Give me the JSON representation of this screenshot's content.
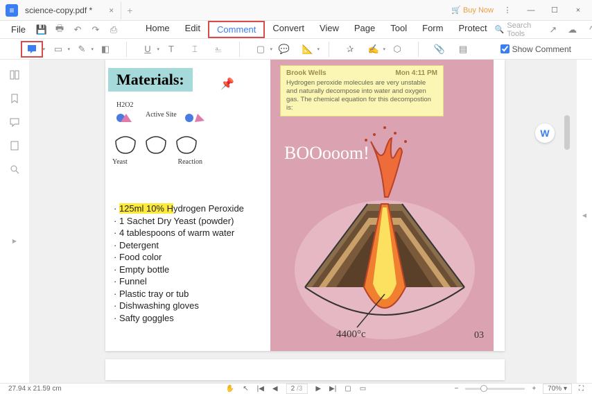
{
  "titlebar": {
    "tab_title": "science-copy.pdf *",
    "buy_now": "Buy Now"
  },
  "menu": {
    "file": "File",
    "tabs": [
      "Home",
      "Edit",
      "Comment",
      "Convert",
      "View",
      "Page",
      "Tool",
      "Form",
      "Protect"
    ],
    "active_tab": "Comment",
    "search_placeholder": "Search Tools"
  },
  "toolbar": {
    "show_comment": "Show Comment",
    "show_comment_checked": true
  },
  "page": {
    "header": "Materials:",
    "diagram": {
      "h2o2": "H2O2",
      "active_site": "Active Site",
      "yeast": "Yeast",
      "reaction": "Reaction"
    },
    "highlight_text": "125ml 10% H",
    "mat_rest_1": "ydrogen Peroxide",
    "materials": [
      "1 Sachet Dry Yeast (powder)",
      "4 tablespoons of warm water",
      "Detergent",
      "Food color",
      "Empty bottle",
      "Funnel",
      "Plastic tray or tub",
      "Dishwashing gloves",
      "Safty goggles"
    ],
    "sticky": {
      "author": "Brook Wells",
      "time": "Mon 4:11 PM",
      "body": "Hydrogen peroxide molecules are very unstable and naturally decompose into water and oxygen gas. The chemical equation for this decompostion is:"
    },
    "boom": "BOOooom!",
    "temperature": "4400°c",
    "page_number": "03"
  },
  "statusbar": {
    "dimensions": "27.94 x 21.59 cm",
    "page_current": "2",
    "page_total": "/3",
    "zoom": "70%"
  }
}
